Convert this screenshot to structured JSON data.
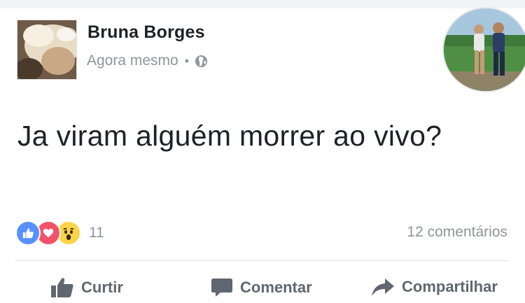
{
  "post": {
    "author": "Bruna Borges",
    "timestamp": "Agora mesmo",
    "separator": "•",
    "privacy_icon": "globe-icon",
    "text": "Ja viram alguém morrer ao vivo?"
  },
  "stats": {
    "reaction_icons": [
      "like-reaction-icon",
      "love-reaction-icon",
      "wow-reaction-icon"
    ],
    "reaction_count": "11",
    "comments": "12 comentários"
  },
  "actions": {
    "like_label": "Curtir",
    "comment_label": "Comentar",
    "share_label": "Compartilhar"
  },
  "colors": {
    "text": "#1d2129",
    "muted": "#90949c",
    "action": "#606770",
    "like_reaction": "#5890ff",
    "love_reaction": "#f25268",
    "wow_reaction": "#fcd447"
  }
}
